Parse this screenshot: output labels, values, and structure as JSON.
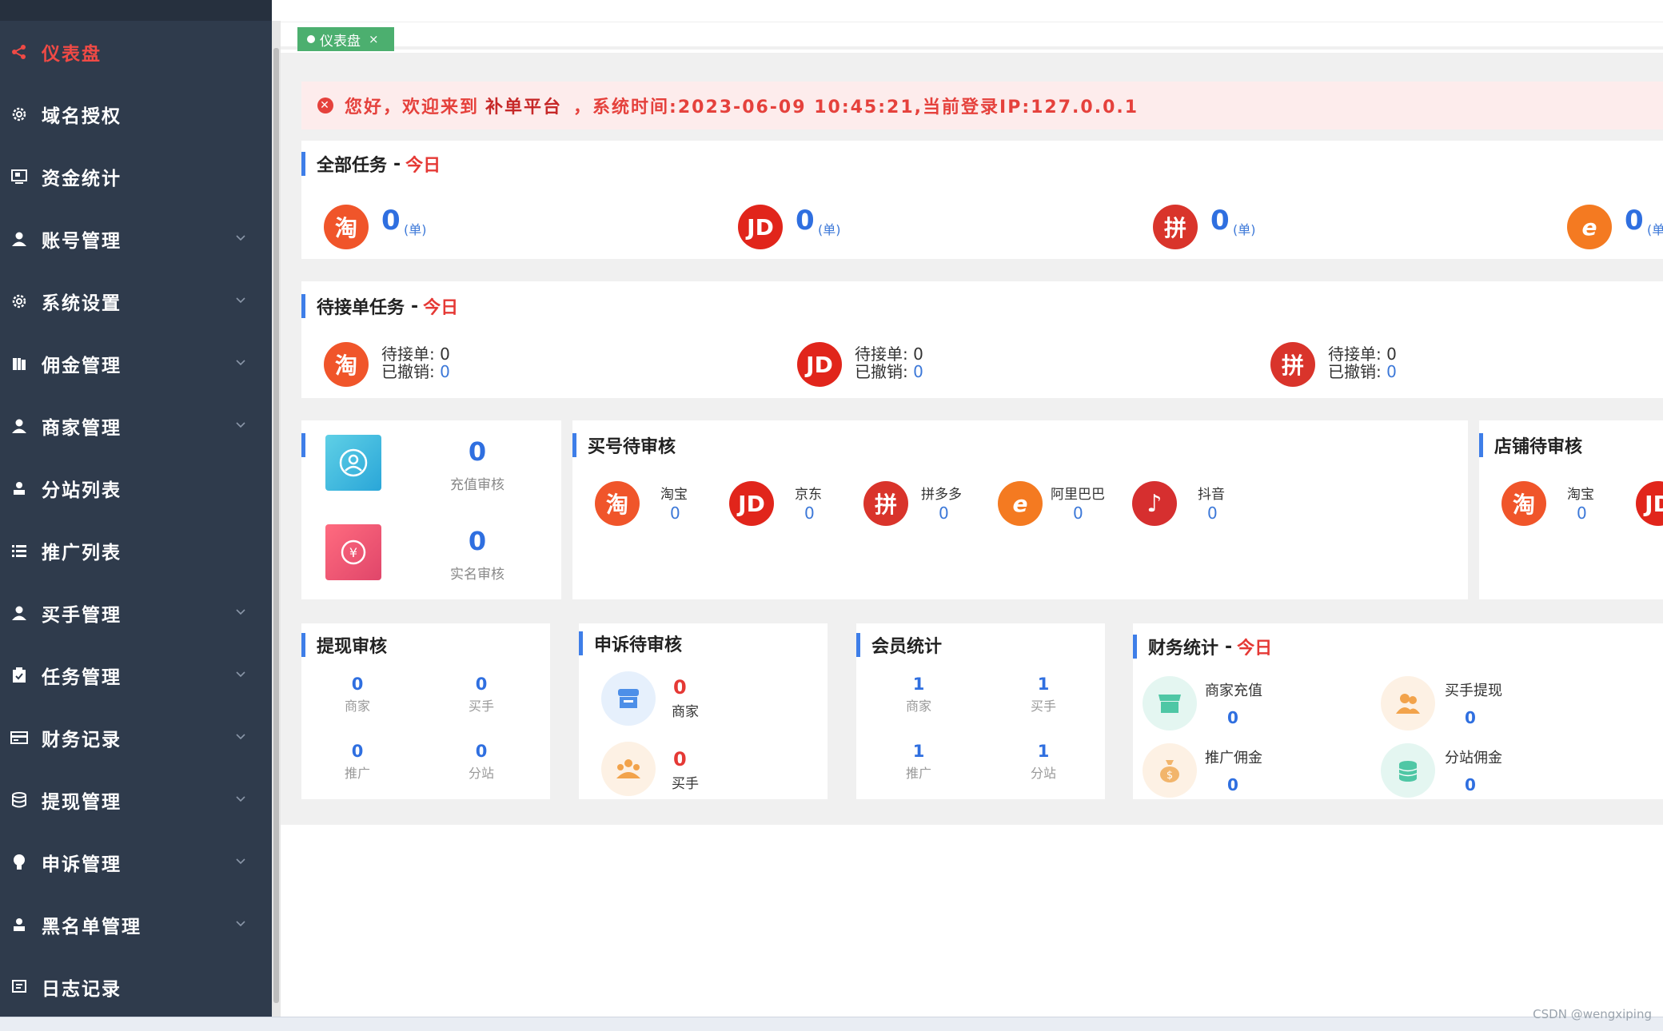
{
  "sidebar": {
    "items": [
      {
        "label": "仪表盘",
        "icon": "share-icon",
        "chevron": false,
        "active": true
      },
      {
        "label": "域名授权",
        "icon": "gear-icon",
        "chevron": false
      },
      {
        "label": "资金统计",
        "icon": "monitor-icon",
        "chevron": false
      },
      {
        "label": "账号管理",
        "icon": "user-icon",
        "chevron": true
      },
      {
        "label": "系统设置",
        "icon": "gear-icon",
        "chevron": true
      },
      {
        "label": "佣金管理",
        "icon": "book-icon",
        "chevron": true
      },
      {
        "label": "商家管理",
        "icon": "user-icon",
        "chevron": true
      },
      {
        "label": "分站列表",
        "icon": "user-small-icon",
        "chevron": false
      },
      {
        "label": "推广列表",
        "icon": "list-icon",
        "chevron": false
      },
      {
        "label": "买手管理",
        "icon": "user-icon",
        "chevron": true
      },
      {
        "label": "任务管理",
        "icon": "clipboard-icon",
        "chevron": true
      },
      {
        "label": "财务记录",
        "icon": "card-icon",
        "chevron": true
      },
      {
        "label": "提现管理",
        "icon": "database-icon",
        "chevron": true
      },
      {
        "label": "申诉管理",
        "icon": "bulb-icon",
        "chevron": true
      },
      {
        "label": "黑名单管理",
        "icon": "user-small-icon",
        "chevron": true
      },
      {
        "label": "日志记录",
        "icon": "message-icon",
        "chevron": false
      }
    ]
  },
  "tabs": [
    {
      "label": "仪表盘",
      "close": "×"
    }
  ],
  "alert": {
    "prefix": "您好，欢迎来到",
    "platform": "补单平台",
    "suffix": "，系统时间:2023-06-09 10:45:21,当前登录IP:127.0.0.1"
  },
  "all_tasks": {
    "title": "全部任务",
    "dash": "-",
    "today": "今日",
    "unit": "(单)",
    "items": [
      {
        "logo": "淘",
        "value": "0"
      },
      {
        "logo": "JD",
        "value": "0"
      },
      {
        "logo": "拼",
        "value": "0"
      },
      {
        "logo": "e",
        "value": "0"
      }
    ]
  },
  "pending_tasks": {
    "title": "待接单任务",
    "dash": "-",
    "today": "今日",
    "waiting_label": "待接单:",
    "cancelled_label": "已撤销:",
    "items": [
      {
        "logo": "淘",
        "waiting": "0",
        "cancelled": "0"
      },
      {
        "logo": "JD",
        "waiting": "0",
        "cancelled": "0"
      },
      {
        "logo": "拼",
        "waiting": "0",
        "cancelled": "0"
      }
    ]
  },
  "review_box": {
    "recharge": {
      "value": "0",
      "label": "充值审核"
    },
    "realname": {
      "value": "0",
      "label": "实名审核"
    }
  },
  "buyer_review": {
    "title": "买号待审核",
    "items": [
      {
        "logo": "淘",
        "name": "淘宝",
        "value": "0"
      },
      {
        "logo": "JD",
        "name": "京东",
        "value": "0"
      },
      {
        "logo": "拼",
        "name": "拼多多",
        "value": "0"
      },
      {
        "logo": "e",
        "name": "阿里巴巴",
        "value": "0"
      },
      {
        "logo": "♪",
        "name": "抖音",
        "value": "0"
      }
    ]
  },
  "shop_review": {
    "title": "店铺待审核",
    "items": [
      {
        "logo": "淘",
        "name": "淘宝",
        "value": "0"
      },
      {
        "logo": "JD"
      }
    ]
  },
  "withdraw_review": {
    "title": "提现审核",
    "items": [
      {
        "value": "0",
        "label": "商家"
      },
      {
        "value": "0",
        "label": "买手"
      },
      {
        "value": "0",
        "label": "推广"
      },
      {
        "value": "0",
        "label": "分站"
      }
    ]
  },
  "appeal_review": {
    "title": "申诉待审核",
    "items": [
      {
        "value": "0",
        "label": "商家"
      },
      {
        "value": "0",
        "label": "买手"
      }
    ]
  },
  "member_stats": {
    "title": "会员统计",
    "items": [
      {
        "value": "1",
        "label": "商家"
      },
      {
        "value": "1",
        "label": "买手"
      },
      {
        "value": "1",
        "label": "推广"
      },
      {
        "value": "1",
        "label": "分站"
      }
    ]
  },
  "finance_stats": {
    "title": "财务统计",
    "dash": "-",
    "today": "今日",
    "items": [
      {
        "label": "商家充值",
        "value": "0"
      },
      {
        "label": "买手提现",
        "value": "0"
      },
      {
        "label": "推广佣金",
        "value": "0"
      },
      {
        "label": "分站佣金",
        "value": "0"
      }
    ]
  },
  "watermark": "CSDN @wengxiping",
  "colors": {
    "sidebar_bg": "#2f3b4c",
    "active": "#f04a45",
    "accent": "#3e7ee8",
    "value_blue": "#2f6fe0"
  }
}
